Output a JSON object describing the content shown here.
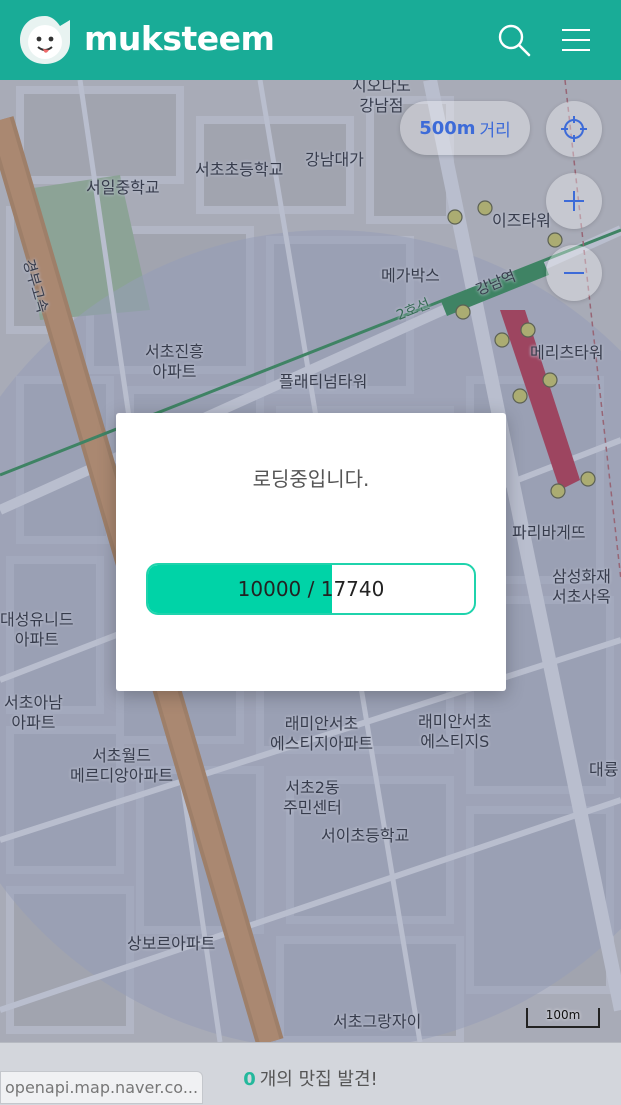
{
  "header": {
    "brand": "muksteem",
    "search_icon": "search-icon",
    "menu_icon": "hamburger-menu-icon"
  },
  "map": {
    "labels": [
      {
        "text": "서초초등학교"
      },
      {
        "text": "강남대가"
      },
      {
        "text": "서일중학교"
      },
      {
        "text": "이즈타워"
      },
      {
        "text": "메가박스"
      },
      {
        "text": "메리츠타워"
      },
      {
        "text": "강남역"
      },
      {
        "text": "2호선"
      },
      {
        "text": "서초진흥\n아파트"
      },
      {
        "text": "플래티넘타워"
      },
      {
        "text": "경부고속"
      },
      {
        "text": "파리바게뜨"
      },
      {
        "text": "삼성화재\n서초사옥"
      },
      {
        "text": "대성유니드\n아파트"
      },
      {
        "text": "서초아남\n아파트"
      },
      {
        "text": "서초월드\n메르디앙아파트"
      },
      {
        "text": "래미안서초\n에스티지아파트"
      },
      {
        "text": "래미안서초\n에스티지S"
      },
      {
        "text": "서초2동\n주민센터"
      },
      {
        "text": "서이초등학교"
      },
      {
        "text": "상보르아파트"
      },
      {
        "text": "서초그랑자이"
      },
      {
        "text": "대륭"
      },
      {
        "text": "지오다노\n강남점"
      }
    ],
    "distance": {
      "value": "500m",
      "unit": "거리"
    },
    "scale": "100m",
    "controls": {
      "locate_icon": "crosshair-icon",
      "zoom_in_icon": "plus-icon",
      "zoom_out_icon": "minus-icon"
    }
  },
  "loading": {
    "message": "로딩중입니다.",
    "current": 10000,
    "total": 17740,
    "progress_text": "10000 / 17740",
    "fraction": 0.5637
  },
  "footer": {
    "count": "0",
    "text": "개의 맛집 발견!",
    "url_tooltip": "openapi.map.naver.co..."
  },
  "colors": {
    "header": "#19ac97",
    "accent": "#00d3a7",
    "distance_text": "#3d6bd8"
  }
}
